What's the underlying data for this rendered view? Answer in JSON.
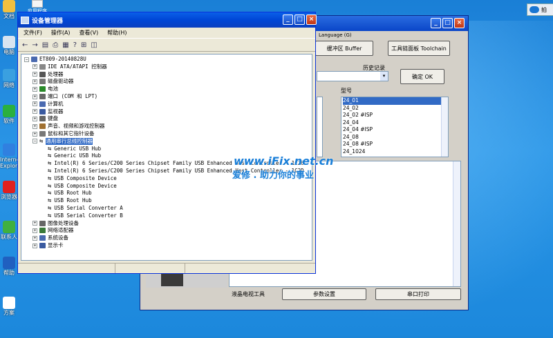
{
  "desktop": {
    "icons": [
      {
        "label": "文档",
        "icon": "folder-icon",
        "color": "#f0c040"
      },
      {
        "label": "电脑",
        "icon": "computer-icon",
        "color": "#d8e4f0"
      },
      {
        "label": "网络",
        "icon": "network-icon",
        "color": "#3aa0e0"
      },
      {
        "label": "软件",
        "icon": "app-icon",
        "color": "#2ab040"
      },
      {
        "label": "Internet Explorer",
        "icon": "ie-icon",
        "color": "#3080e0"
      },
      {
        "label": "浏览器",
        "icon": "opera-icon",
        "color": "#e02020"
      },
      {
        "label": "联系人",
        "icon": "people-icon",
        "color": "#40b040"
      },
      {
        "label": "帮助",
        "icon": "help-icon",
        "color": "#2060c0"
      },
      {
        "label": "方案",
        "icon": "doc-icon",
        "color": "#ffffff"
      }
    ],
    "top_icon_label": "应用程序",
    "top_right_button_label": "拍"
  },
  "back_window": {
    "menu_language": "Language (G)",
    "buttons": {
      "buffer": "缓冲区 Buffer",
      "toolchain": "工具链面板 Toolchain",
      "ok": "确定 OK",
      "params": "参数设置",
      "serial_print": "串口打印"
    },
    "history_label": "历史记录",
    "model_label": "型号",
    "models": [
      "24_01",
      "24_02",
      "24_02 #ISP",
      "24_04",
      "24_04 #ISP",
      "24_08",
      "24_08 #ISP",
      "24_1024"
    ],
    "selected_model": "24_01",
    "lcd_tool_label": "液晶电视工具"
  },
  "device_manager": {
    "title": "设备管理器",
    "menu": [
      "文件(F)",
      "操作(A)",
      "查看(V)",
      "帮助(H)"
    ],
    "computer_name": "ET809-20140828U",
    "categories": [
      {
        "label": "IDE ATA/ATAPI 控制器",
        "icon": "ide-icon",
        "color": "#888888"
      },
      {
        "label": "处理器",
        "icon": "cpu-icon",
        "color": "#555555"
      },
      {
        "label": "磁盘驱动器",
        "icon": "disk-icon",
        "color": "#777777"
      },
      {
        "label": "电池",
        "icon": "battery-icon",
        "color": "#2a8a2a"
      },
      {
        "label": "端口 (COM 和 LPT)",
        "icon": "port-icon",
        "color": "#6a6a6a"
      },
      {
        "label": "计算机",
        "icon": "computer-icon",
        "color": "#4a6ab0"
      },
      {
        "label": "监视器",
        "icon": "monitor-icon",
        "color": "#3a5aa0"
      },
      {
        "label": "键盘",
        "icon": "keyboard-icon",
        "color": "#666666"
      },
      {
        "label": "声音、视频和游戏控制器",
        "icon": "sound-icon",
        "color": "#a07030"
      },
      {
        "label": "鼠标和其它指针设备",
        "icon": "mouse-icon",
        "color": "#777777"
      }
    ],
    "usb_category": "通用串行总线控制器",
    "usb_devices": [
      "Generic USB Hub",
      "Generic USB Hub",
      "Intel(R) 6 Series/C200 Series Chipset Family USB Enhanced Host Controller - 1C26",
      "Intel(R) 6 Series/C200 Series Chipset Family USB Enhanced Host Controller - 1C2D",
      "USB Composite Device",
      "USB Composite Device",
      "USB Root Hub",
      "USB Root Hub",
      "USB Serial Converter A",
      "USB Serial Converter B"
    ],
    "trailing_categories": [
      {
        "label": "图像处理设备",
        "icon": "camera-icon",
        "color": "#666666"
      },
      {
        "label": "网络适配器",
        "icon": "network-adapter-icon",
        "color": "#3a7a3a"
      },
      {
        "label": "系统设备",
        "icon": "system-icon",
        "color": "#4a6ab0"
      },
      {
        "label": "显示卡",
        "icon": "display-icon",
        "color": "#3a5aa0"
      }
    ]
  },
  "watermark": {
    "site": "www.iFix.net.cn",
    "slogan": "爱修 . 助力你的事业"
  },
  "colors": {
    "titlebar": "#0a52de",
    "selection": "#316ac5",
    "watermark_blue": "#1a7fd8"
  }
}
